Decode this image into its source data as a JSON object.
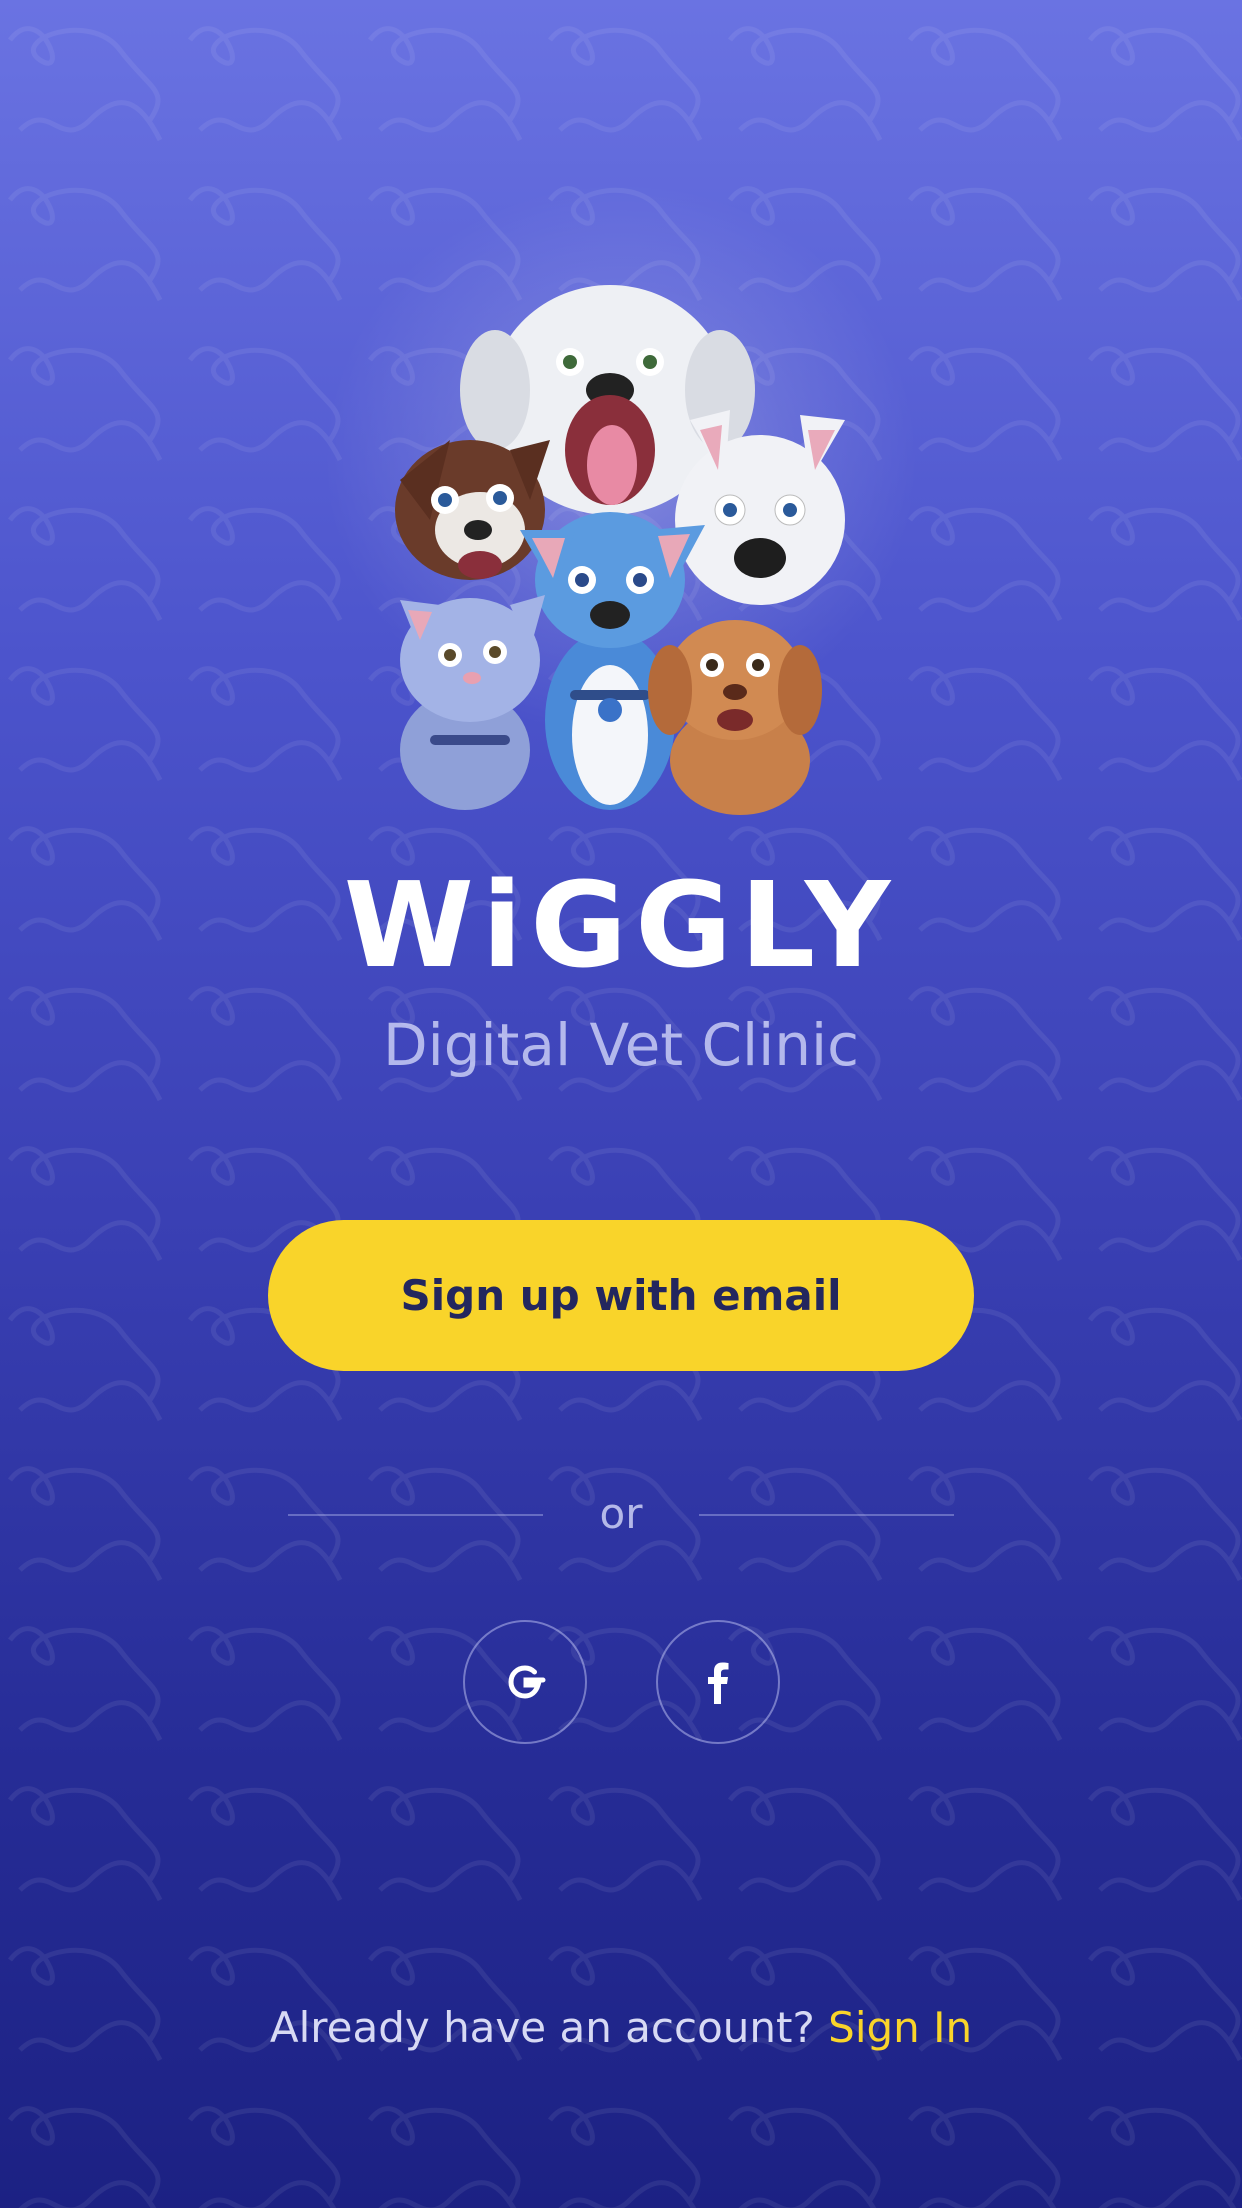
{
  "app": {
    "brand": "WiGGLY",
    "subtitle": "Digital Vet Clinic"
  },
  "actions": {
    "signup_label": "Sign up with email",
    "divider_text": "or",
    "social": [
      {
        "name": "google",
        "icon": "google-icon"
      },
      {
        "name": "facebook",
        "icon": "facebook-icon"
      }
    ]
  },
  "footer": {
    "prompt": "Already have an account?",
    "signin_label": "Sign In"
  },
  "colors": {
    "accent": "#f9d42a",
    "background_top": "#6a73e2",
    "background_bottom": "#1c2183",
    "button_text": "#23275e"
  }
}
